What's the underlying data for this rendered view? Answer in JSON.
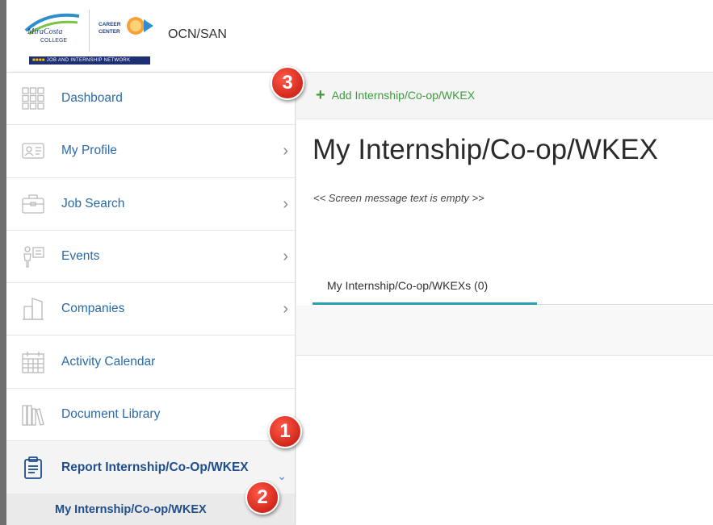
{
  "header": {
    "logo_miracosta_text": "MiraCosta College",
    "logo_career_text": "Career Center",
    "org_code": "OCN/SAN",
    "network_strip": "JOB AND INTERNSHIP NETWORK"
  },
  "sidebar": {
    "items": [
      {
        "label": "Dashboard",
        "icon": "dashboard-icon",
        "has_chevron": false
      },
      {
        "label": "My Profile",
        "icon": "profile-card-icon",
        "has_chevron": true
      },
      {
        "label": "Job Search",
        "icon": "briefcase-icon",
        "has_chevron": true
      },
      {
        "label": "Events",
        "icon": "events-icon",
        "has_chevron": true
      },
      {
        "label": "Companies",
        "icon": "buildings-icon",
        "has_chevron": true
      },
      {
        "label": "Activity Calendar",
        "icon": "calendar-icon",
        "has_chevron": false
      },
      {
        "label": "Document Library",
        "icon": "books-icon",
        "has_chevron": false
      },
      {
        "label": "Report Internship/Co-Op/WKEX",
        "icon": "clipboard-icon",
        "has_chevron": true,
        "expanded": true
      }
    ],
    "sub_items": [
      {
        "label": "My Internship/Co-op/WKEX"
      }
    ]
  },
  "main": {
    "add_button_label": "Add Internship/Co-op/WKEX",
    "title": "My Internship/Co-op/WKEX",
    "screen_message": "<< Screen message text is empty >>",
    "tabs": [
      {
        "label": "My Internship/Co-op/WKEXs (0)",
        "active": true
      }
    ]
  },
  "callouts": {
    "one": "1",
    "two": "2",
    "three": "3"
  },
  "colors": {
    "link_blue": "#2a6aa8",
    "active_blue": "#1f4e8a",
    "add_green": "#3d9a3d",
    "tab_accent": "#2aa0b8",
    "callout_red": "#d2281c"
  }
}
